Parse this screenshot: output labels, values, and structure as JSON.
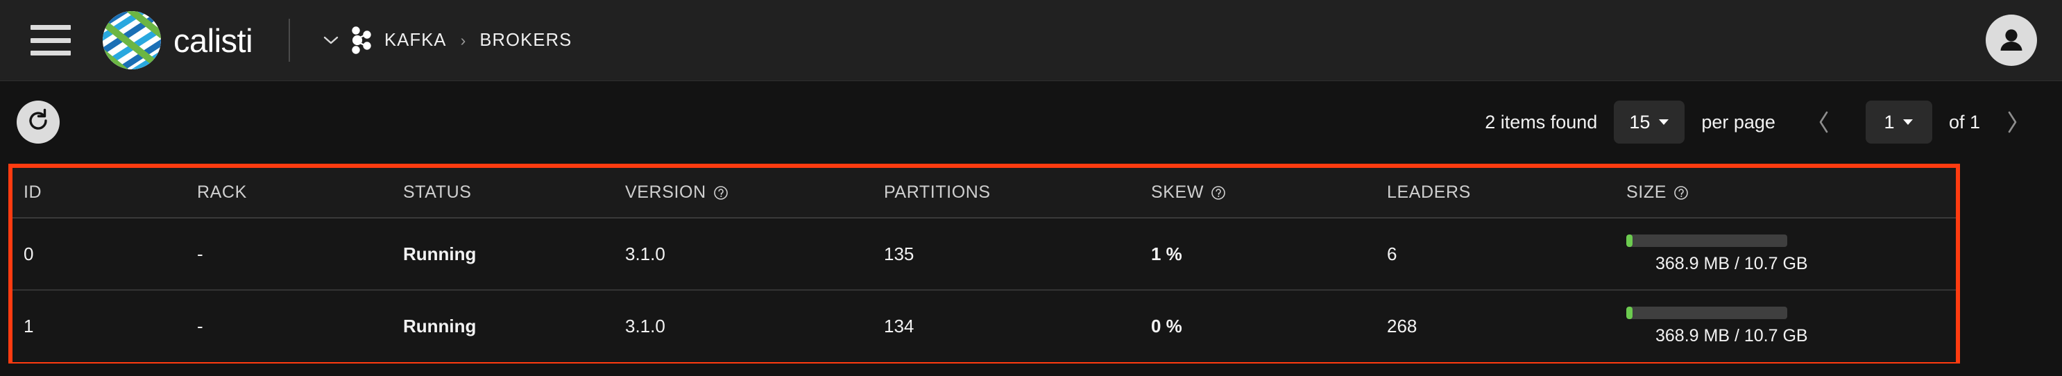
{
  "topbar": {
    "menu_icon": "hamburger-menu-icon",
    "brand_name": "calisti",
    "brand_logo_icon": "calisti-logo-icon",
    "breadcrumb": {
      "caret_icon": "chevron-down-icon",
      "context_icon": "kafka-icon",
      "items": [
        "KAFKA",
        "BROKERS"
      ],
      "separator": "›"
    },
    "avatar_icon": "user-avatar-icon"
  },
  "toolbar": {
    "refresh_icon": "refresh-icon",
    "items_found": "2 items found",
    "page_size": "15",
    "per_page_label": "per page",
    "prev_icon": "chevron-left-icon",
    "current_page": "1",
    "of_label": "of 1",
    "next_icon": "chevron-right-icon",
    "caret_icon": "caret-down-icon"
  },
  "table": {
    "columns": [
      {
        "label": "ID",
        "help": false
      },
      {
        "label": "RACK",
        "help": false
      },
      {
        "label": "STATUS",
        "help": false
      },
      {
        "label": "VERSION",
        "help": true
      },
      {
        "label": "PARTITIONS",
        "help": false
      },
      {
        "label": "SKEW",
        "help": true
      },
      {
        "label": "LEADERS",
        "help": false
      },
      {
        "label": "SIZE",
        "help": true
      }
    ],
    "help_icon": "help-circle-icon",
    "rows": [
      {
        "id": "0",
        "rack": "-",
        "status": "Running",
        "version": "3.1.0",
        "partitions": "135",
        "skew": "1 %",
        "leaders": "6",
        "size_label": "368.9 MB / 10.7 GB",
        "size_percent": 4
      },
      {
        "id": "1",
        "rack": "-",
        "status": "Running",
        "version": "3.1.0",
        "partitions": "134",
        "skew": "0 %",
        "leaders": "268",
        "size_label": "368.9 MB / 10.7 GB",
        "size_percent": 4
      }
    ]
  },
  "colors": {
    "accent_green": "#5cb947",
    "highlight_border": "#ff3b10",
    "topbar_bg": "#212121",
    "page_bg": "#131313",
    "row_bg": "#161616",
    "header_row_bg": "#1b1b1b"
  }
}
